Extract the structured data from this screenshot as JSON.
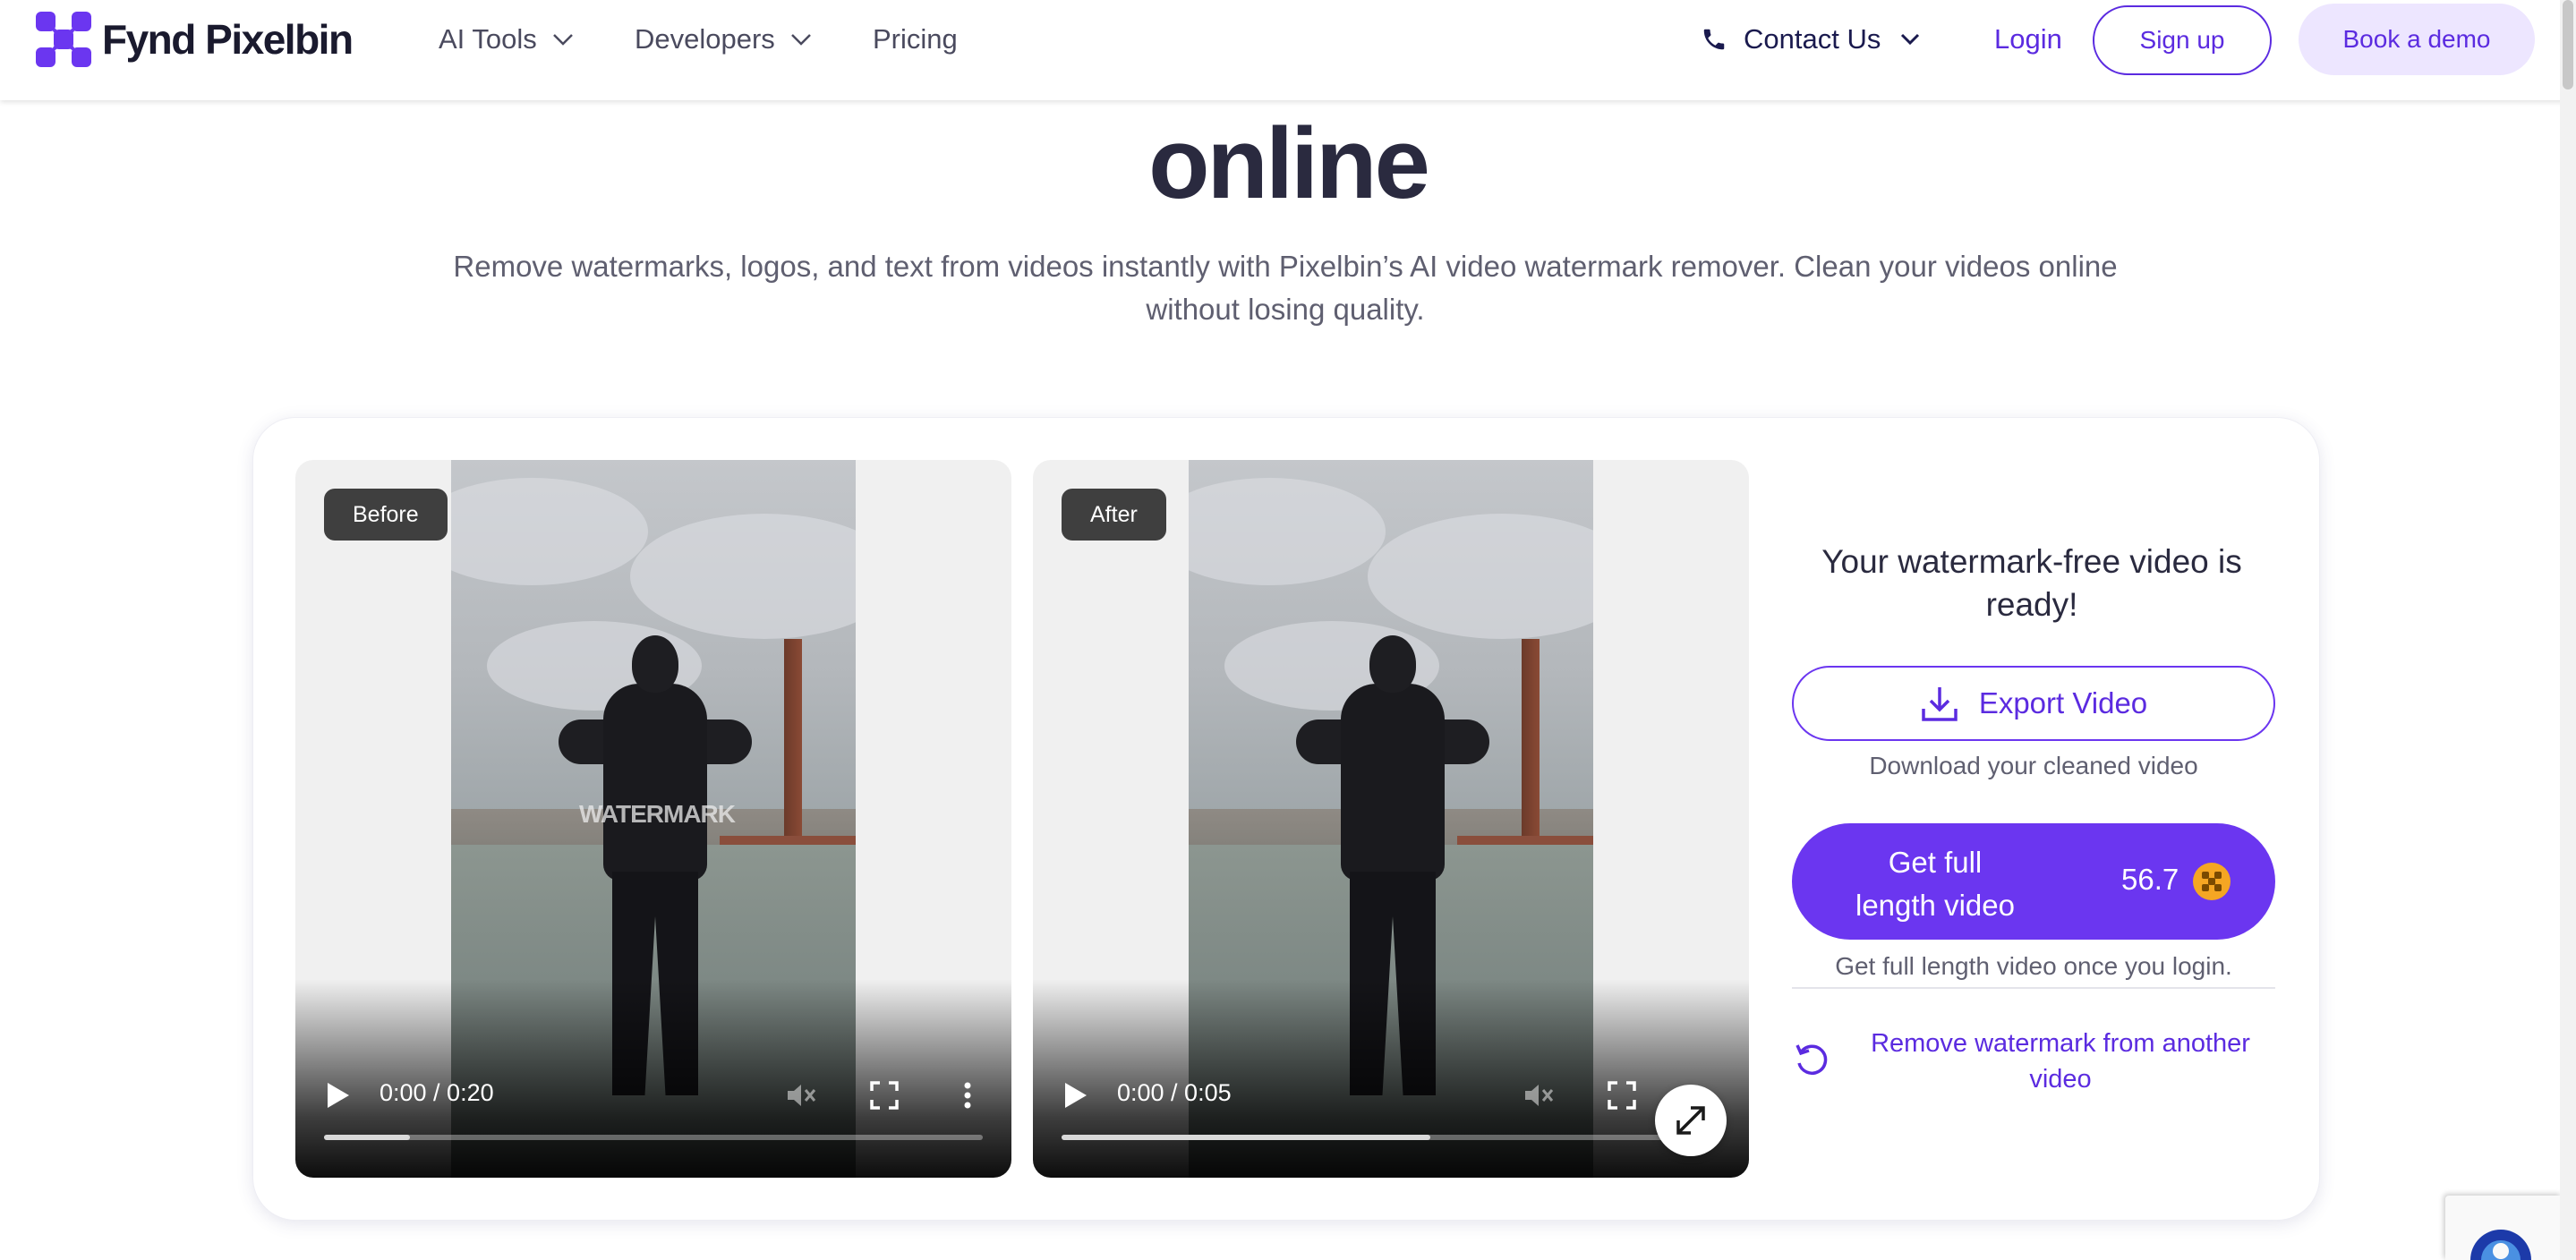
{
  "nav": {
    "brand": "Fynd Pixelbin",
    "items": [
      {
        "label": "AI Tools",
        "has_dropdown": true
      },
      {
        "label": "Developers",
        "has_dropdown": true
      },
      {
        "label": "Pricing",
        "has_dropdown": false
      }
    ],
    "contact_label": "Contact Us",
    "login_label": "Login",
    "signup_label": "Sign up",
    "demo_label": "Book a demo"
  },
  "hero": {
    "title": "online",
    "subtitle": "Remove watermarks, logos, and text from videos instantly with Pixelbin’s AI video watermark remover. Clean your videos online without losing quality."
  },
  "videos": {
    "before": {
      "badge": "Before",
      "time": "0:00 / 0:20",
      "watermark": "WATERMARK",
      "progress_buffered": 0.13
    },
    "after": {
      "badge": "After",
      "time": "0:00 / 0:05",
      "progress_buffered": 0.56
    }
  },
  "result": {
    "ready_title": "Your watermark-free video is ready!",
    "export_label": "Export Video",
    "export_note": "Download your cleaned video",
    "full_length_label": "Get full length video",
    "full_length_cost": "56.7",
    "full_length_note": "Get full length video once you login.",
    "another_label": "Remove watermark from another video"
  },
  "colors": {
    "brand_purple": "#6b36f0",
    "link_purple": "#5b2be0",
    "demo_bg": "#ede6ff",
    "coin": "#f5a623"
  },
  "icons": {
    "phone": "phone-icon",
    "chevron": "chevron-down-icon",
    "download": "download-icon",
    "coin": "coin-icon",
    "refresh": "refresh-icon",
    "expand": "expand-icon"
  }
}
